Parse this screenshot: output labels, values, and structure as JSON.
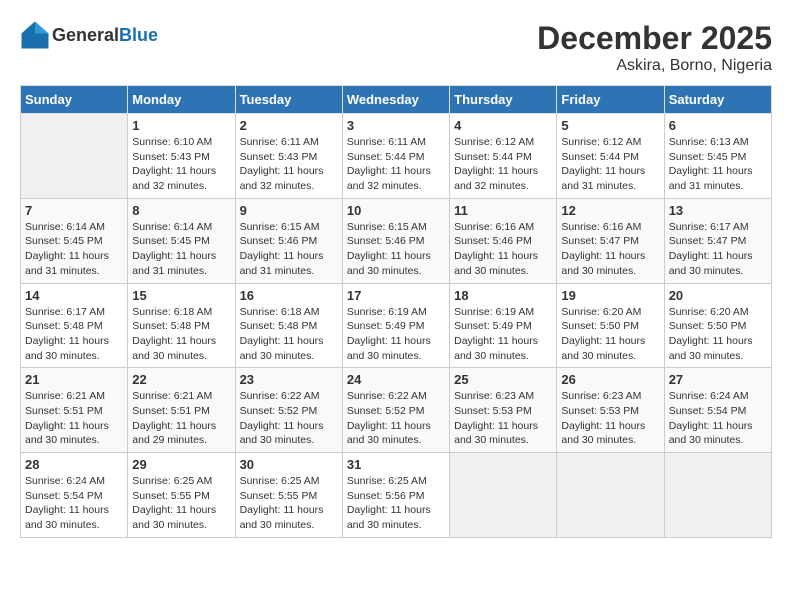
{
  "header": {
    "logo_general": "General",
    "logo_blue": "Blue",
    "title": "December 2025",
    "subtitle": "Askira, Borno, Nigeria"
  },
  "weekdays": [
    "Sunday",
    "Monday",
    "Tuesday",
    "Wednesday",
    "Thursday",
    "Friday",
    "Saturday"
  ],
  "weeks": [
    [
      {
        "day": "",
        "sunrise": "",
        "sunset": "",
        "daylight": ""
      },
      {
        "day": "1",
        "sunrise": "Sunrise: 6:10 AM",
        "sunset": "Sunset: 5:43 PM",
        "daylight": "Daylight: 11 hours and 32 minutes."
      },
      {
        "day": "2",
        "sunrise": "Sunrise: 6:11 AM",
        "sunset": "Sunset: 5:43 PM",
        "daylight": "Daylight: 11 hours and 32 minutes."
      },
      {
        "day": "3",
        "sunrise": "Sunrise: 6:11 AM",
        "sunset": "Sunset: 5:44 PM",
        "daylight": "Daylight: 11 hours and 32 minutes."
      },
      {
        "day": "4",
        "sunrise": "Sunrise: 6:12 AM",
        "sunset": "Sunset: 5:44 PM",
        "daylight": "Daylight: 11 hours and 32 minutes."
      },
      {
        "day": "5",
        "sunrise": "Sunrise: 6:12 AM",
        "sunset": "Sunset: 5:44 PM",
        "daylight": "Daylight: 11 hours and 31 minutes."
      },
      {
        "day": "6",
        "sunrise": "Sunrise: 6:13 AM",
        "sunset": "Sunset: 5:45 PM",
        "daylight": "Daylight: 11 hours and 31 minutes."
      }
    ],
    [
      {
        "day": "7",
        "sunrise": "Sunrise: 6:14 AM",
        "sunset": "Sunset: 5:45 PM",
        "daylight": "Daylight: 11 hours and 31 minutes."
      },
      {
        "day": "8",
        "sunrise": "Sunrise: 6:14 AM",
        "sunset": "Sunset: 5:45 PM",
        "daylight": "Daylight: 11 hours and 31 minutes."
      },
      {
        "day": "9",
        "sunrise": "Sunrise: 6:15 AM",
        "sunset": "Sunset: 5:46 PM",
        "daylight": "Daylight: 11 hours and 31 minutes."
      },
      {
        "day": "10",
        "sunrise": "Sunrise: 6:15 AM",
        "sunset": "Sunset: 5:46 PM",
        "daylight": "Daylight: 11 hours and 30 minutes."
      },
      {
        "day": "11",
        "sunrise": "Sunrise: 6:16 AM",
        "sunset": "Sunset: 5:46 PM",
        "daylight": "Daylight: 11 hours and 30 minutes."
      },
      {
        "day": "12",
        "sunrise": "Sunrise: 6:16 AM",
        "sunset": "Sunset: 5:47 PM",
        "daylight": "Daylight: 11 hours and 30 minutes."
      },
      {
        "day": "13",
        "sunrise": "Sunrise: 6:17 AM",
        "sunset": "Sunset: 5:47 PM",
        "daylight": "Daylight: 11 hours and 30 minutes."
      }
    ],
    [
      {
        "day": "14",
        "sunrise": "Sunrise: 6:17 AM",
        "sunset": "Sunset: 5:48 PM",
        "daylight": "Daylight: 11 hours and 30 minutes."
      },
      {
        "day": "15",
        "sunrise": "Sunrise: 6:18 AM",
        "sunset": "Sunset: 5:48 PM",
        "daylight": "Daylight: 11 hours and 30 minutes."
      },
      {
        "day": "16",
        "sunrise": "Sunrise: 6:18 AM",
        "sunset": "Sunset: 5:48 PM",
        "daylight": "Daylight: 11 hours and 30 minutes."
      },
      {
        "day": "17",
        "sunrise": "Sunrise: 6:19 AM",
        "sunset": "Sunset: 5:49 PM",
        "daylight": "Daylight: 11 hours and 30 minutes."
      },
      {
        "day": "18",
        "sunrise": "Sunrise: 6:19 AM",
        "sunset": "Sunset: 5:49 PM",
        "daylight": "Daylight: 11 hours and 30 minutes."
      },
      {
        "day": "19",
        "sunrise": "Sunrise: 6:20 AM",
        "sunset": "Sunset: 5:50 PM",
        "daylight": "Daylight: 11 hours and 30 minutes."
      },
      {
        "day": "20",
        "sunrise": "Sunrise: 6:20 AM",
        "sunset": "Sunset: 5:50 PM",
        "daylight": "Daylight: 11 hours and 30 minutes."
      }
    ],
    [
      {
        "day": "21",
        "sunrise": "Sunrise: 6:21 AM",
        "sunset": "Sunset: 5:51 PM",
        "daylight": "Daylight: 11 hours and 30 minutes."
      },
      {
        "day": "22",
        "sunrise": "Sunrise: 6:21 AM",
        "sunset": "Sunset: 5:51 PM",
        "daylight": "Daylight: 11 hours and 29 minutes."
      },
      {
        "day": "23",
        "sunrise": "Sunrise: 6:22 AM",
        "sunset": "Sunset: 5:52 PM",
        "daylight": "Daylight: 11 hours and 30 minutes."
      },
      {
        "day": "24",
        "sunrise": "Sunrise: 6:22 AM",
        "sunset": "Sunset: 5:52 PM",
        "daylight": "Daylight: 11 hours and 30 minutes."
      },
      {
        "day": "25",
        "sunrise": "Sunrise: 6:23 AM",
        "sunset": "Sunset: 5:53 PM",
        "daylight": "Daylight: 11 hours and 30 minutes."
      },
      {
        "day": "26",
        "sunrise": "Sunrise: 6:23 AM",
        "sunset": "Sunset: 5:53 PM",
        "daylight": "Daylight: 11 hours and 30 minutes."
      },
      {
        "day": "27",
        "sunrise": "Sunrise: 6:24 AM",
        "sunset": "Sunset: 5:54 PM",
        "daylight": "Daylight: 11 hours and 30 minutes."
      }
    ],
    [
      {
        "day": "28",
        "sunrise": "Sunrise: 6:24 AM",
        "sunset": "Sunset: 5:54 PM",
        "daylight": "Daylight: 11 hours and 30 minutes."
      },
      {
        "day": "29",
        "sunrise": "Sunrise: 6:25 AM",
        "sunset": "Sunset: 5:55 PM",
        "daylight": "Daylight: 11 hours and 30 minutes."
      },
      {
        "day": "30",
        "sunrise": "Sunrise: 6:25 AM",
        "sunset": "Sunset: 5:55 PM",
        "daylight": "Daylight: 11 hours and 30 minutes."
      },
      {
        "day": "31",
        "sunrise": "Sunrise: 6:25 AM",
        "sunset": "Sunset: 5:56 PM",
        "daylight": "Daylight: 11 hours and 30 minutes."
      },
      {
        "day": "",
        "sunrise": "",
        "sunset": "",
        "daylight": ""
      },
      {
        "day": "",
        "sunrise": "",
        "sunset": "",
        "daylight": ""
      },
      {
        "day": "",
        "sunrise": "",
        "sunset": "",
        "daylight": ""
      }
    ]
  ]
}
